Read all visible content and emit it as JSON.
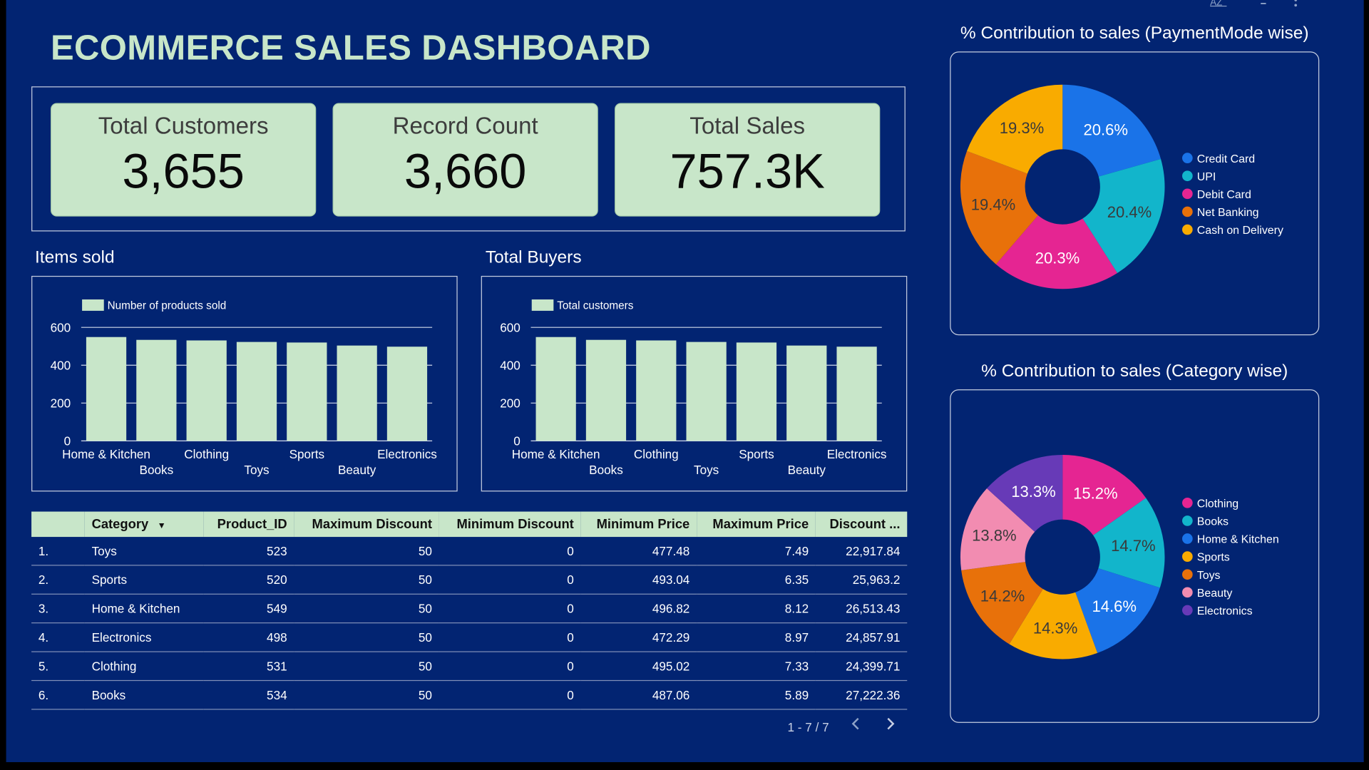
{
  "dashboard": {
    "title": "ECOMMERCE SALES DASHBOARD"
  },
  "toolbar": {
    "sort_icon": "sort-az-icon",
    "filter_icon": "filter-icon",
    "menu_icon": "more-vert-icon"
  },
  "kpis": [
    {
      "label": "Total Customers",
      "value": "3,655"
    },
    {
      "label": "Record Count",
      "value": "3,660"
    },
    {
      "label": "Total Sales",
      "value": "757.3K"
    }
  ],
  "colors": {
    "background": "#022472",
    "accent": "#c8e6c9",
    "pie": [
      "#1a73e8",
      "#12b5cb",
      "#e52592",
      "#e8710a",
      "#f9ab00",
      "#f28cb1",
      "#673ab7"
    ]
  },
  "items_sold": {
    "title": "Items sold"
  },
  "total_buyers": {
    "title": "Total Buyers"
  },
  "pie_payment": {
    "title": "% Contribution to sales (PaymentMode wise)"
  },
  "pie_category": {
    "title": "% Contribution to sales (Category wise)"
  },
  "chart_data": [
    {
      "type": "bar",
      "title": "Items sold",
      "categories": [
        "Home & Kitchen",
        "Books",
        "Clothing",
        "Toys",
        "Sports",
        "Beauty",
        "Electronics"
      ],
      "series": [
        {
          "name": "Number of products sold",
          "values": [
            549,
            534,
            531,
            523,
            520,
            504,
            498
          ]
        }
      ],
      "ylim": [
        0,
        600
      ],
      "yticks": [
        0,
        200,
        400,
        600
      ],
      "legend": "top-left"
    },
    {
      "type": "bar",
      "title": "Total Buyers",
      "categories": [
        "Home & Kitchen",
        "Books",
        "Clothing",
        "Toys",
        "Sports",
        "Beauty",
        "Electronics"
      ],
      "series": [
        {
          "name": "Total customers",
          "values": [
            549,
            534,
            531,
            523,
            520,
            504,
            498
          ]
        }
      ],
      "ylim": [
        0,
        600
      ],
      "yticks": [
        0,
        200,
        400,
        600
      ],
      "legend": "top-left"
    },
    {
      "type": "pie",
      "title": "% Contribution to sales (PaymentMode wise)",
      "labels": [
        "Credit Card",
        "UPI",
        "Debit Card",
        "Net Banking",
        "Cash on Delivery"
      ],
      "values": [
        20.6,
        20.4,
        20.3,
        19.4,
        19.3
      ],
      "value_labels": [
        "20.6%",
        "20.4%",
        "20.3%",
        "19.4%",
        "19.3%"
      ],
      "colors": [
        "#1a73e8",
        "#12b5cb",
        "#e52592",
        "#e8710a",
        "#f9ab00"
      ],
      "legend": "right"
    },
    {
      "type": "pie",
      "title": "% Contribution to sales (Category wise)",
      "labels": [
        "Clothing",
        "Books",
        "Home & Kitchen",
        "Sports",
        "Toys",
        "Beauty",
        "Electronics"
      ],
      "values": [
        15.2,
        14.7,
        14.6,
        14.3,
        14.2,
        13.8,
        13.3
      ],
      "value_labels": [
        "15.2%",
        "14.7%",
        "14.6%",
        "14.3%",
        "14.2%",
        "13.8%",
        "13.3%"
      ],
      "colors": [
        "#e52592",
        "#12b5cb",
        "#1a73e8",
        "#f9ab00",
        "#e8710a",
        "#f28cb1",
        "#673ab7"
      ],
      "legend": "right"
    },
    {
      "type": "table",
      "columns": [
        "Category",
        "Product_ID",
        "Maximum Discount",
        "Minimum Discount",
        "Minimum Price",
        "Maximum Price",
        "Discount ..."
      ],
      "sort_icon": "sort-desc-icon",
      "rows": [
        {
          "idx": "1.",
          "category": "Toys",
          "product_id": "523",
          "max_discount": "50",
          "min_discount": "0",
          "min_price": "477.48",
          "max_price": "7.49",
          "discount": "22,917.84"
        },
        {
          "idx": "2.",
          "category": "Sports",
          "product_id": "520",
          "max_discount": "50",
          "min_discount": "0",
          "min_price": "493.04",
          "max_price": "6.35",
          "discount": "25,963.2"
        },
        {
          "idx": "3.",
          "category": "Home & Kitchen",
          "product_id": "549",
          "max_discount": "50",
          "min_discount": "0",
          "min_price": "496.82",
          "max_price": "8.12",
          "discount": "26,513.43"
        },
        {
          "idx": "4.",
          "category": "Electronics",
          "product_id": "498",
          "max_discount": "50",
          "min_discount": "0",
          "min_price": "472.29",
          "max_price": "8.97",
          "discount": "24,857.91"
        },
        {
          "idx": "5.",
          "category": "Clothing",
          "product_id": "531",
          "max_discount": "50",
          "min_discount": "0",
          "min_price": "495.02",
          "max_price": "7.33",
          "discount": "24,399.71"
        },
        {
          "idx": "6.",
          "category": "Books",
          "product_id": "534",
          "max_discount": "50",
          "min_discount": "0",
          "min_price": "487.06",
          "max_price": "5.89",
          "discount": "27,222.36"
        }
      ]
    }
  ],
  "pagination": {
    "label": "1 - 7 / 7",
    "prev_icon": "chevron-left-icon",
    "next_icon": "chevron-right-icon"
  }
}
